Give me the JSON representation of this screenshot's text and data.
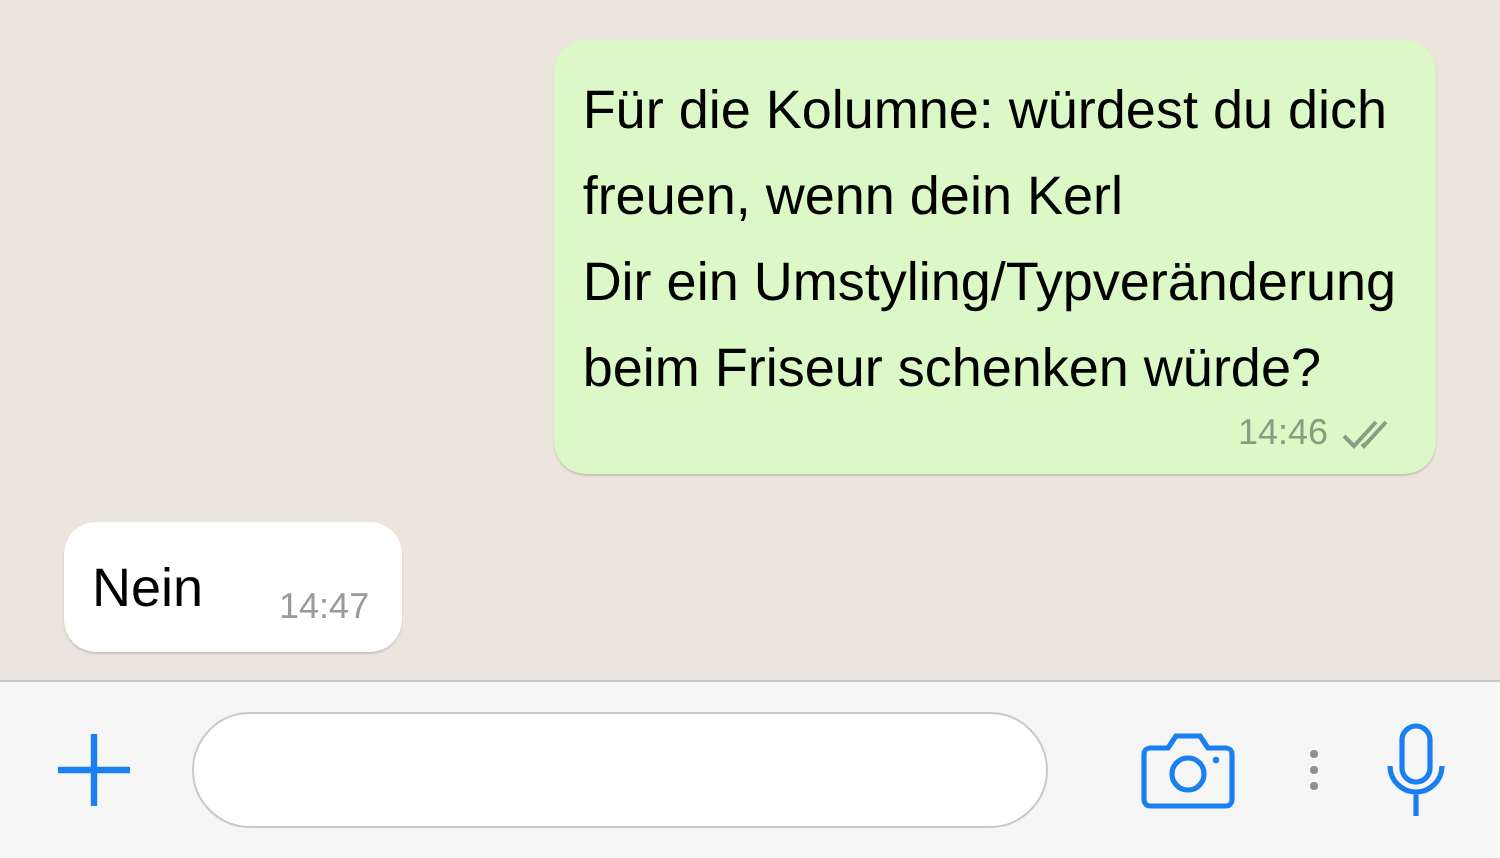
{
  "messages": [
    {
      "kind": "out",
      "lines": [
        "Für die Kolumne: würdest du dich",
        "freuen, wenn dein Kerl",
        "Dir ein Umstyling/Typveränderung",
        "beim Friseur schenken würde?"
      ],
      "time": "14:46",
      "read": false
    },
    {
      "kind": "in",
      "lines": [
        "Nein"
      ],
      "time": "14:47"
    }
  ]
}
